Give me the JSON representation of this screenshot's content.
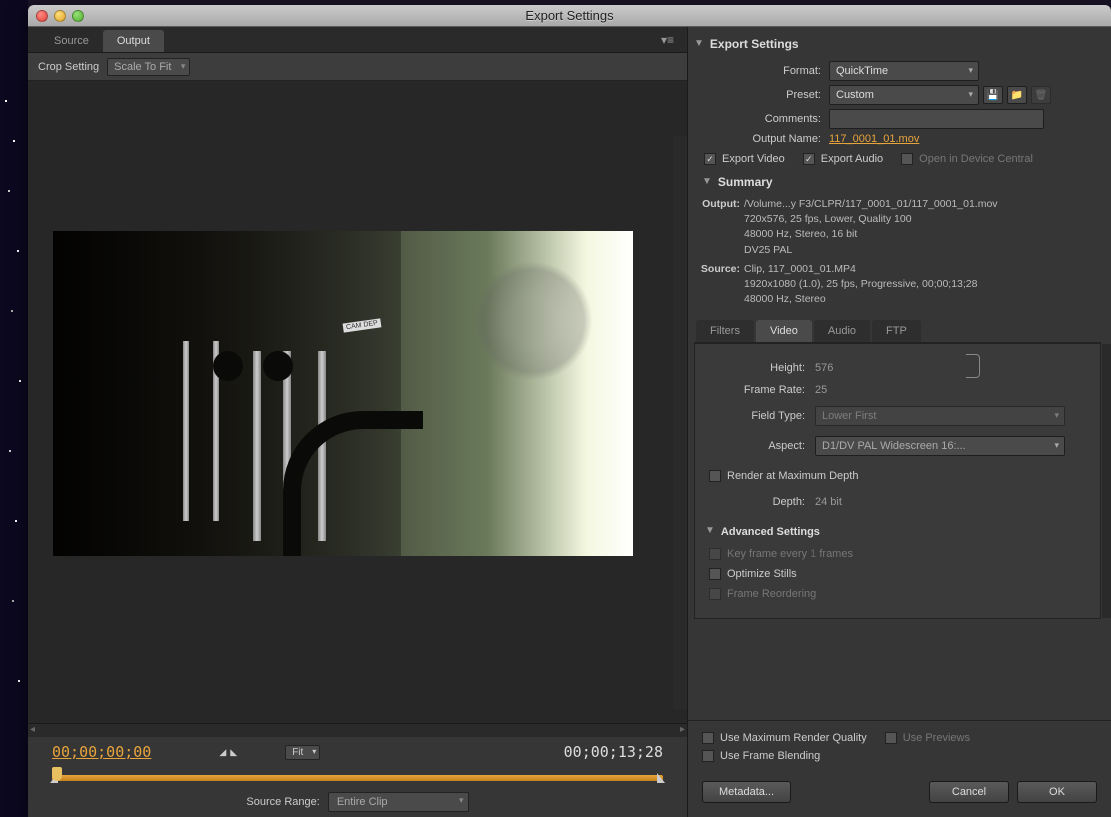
{
  "window": {
    "title": "Export Settings"
  },
  "left": {
    "tabs": {
      "source": "Source",
      "output": "Output"
    },
    "crop_label": "Crop Setting",
    "crop_value": "Scale To Fit",
    "timecode_in": "00;00;00;00",
    "timecode_out": "00;00;13;28",
    "fit_label": "Fit",
    "source_range_label": "Source Range:",
    "source_range_value": "Entire Clip",
    "preview_tag": "CAM DEP"
  },
  "export": {
    "heading": "Export Settings",
    "format_label": "Format:",
    "format_value": "QuickTime",
    "preset_label": "Preset:",
    "preset_value": "Custom",
    "comments_label": "Comments:",
    "output_name_label": "Output Name:",
    "output_name_value": "117_0001_01.mov",
    "export_video": "Export Video",
    "export_audio": "Export Audio",
    "open_device_central": "Open in Device Central"
  },
  "summary": {
    "heading": "Summary",
    "output_label": "Output:",
    "output_line1": "/Volume...y F3/CLPR/117_0001_01/117_0001_01.mov",
    "output_line2": "720x576, 25 fps, Lower, Quality 100",
    "output_line3": "48000 Hz, Stereo, 16 bit",
    "output_line4": "DV25 PAL",
    "source_label": "Source:",
    "source_line1": "Clip, 117_0001_01.MP4",
    "source_line2": "1920x1080 (1.0), 25 fps, Progressive, 00;00;13;28",
    "source_line3": "48000 Hz, Stereo"
  },
  "subtabs": {
    "filters": "Filters",
    "video": "Video",
    "audio": "Audio",
    "ftp": "FTP"
  },
  "video": {
    "height_label": "Height:",
    "height_value": "576",
    "frame_rate_label": "Frame Rate:",
    "frame_rate_value": "25",
    "field_type_label": "Field Type:",
    "field_type_value": "Lower First",
    "aspect_label": "Aspect:",
    "aspect_value": "D1/DV PAL Widescreen 16:...",
    "render_max_depth": "Render at Maximum Depth",
    "depth_label": "Depth:",
    "depth_value": "24 bit"
  },
  "advanced": {
    "heading": "Advanced Settings",
    "keyframe_label": "Key frame every",
    "keyframe_value": "1",
    "keyframe_unit": "frames",
    "optimize_stills": "Optimize Stills",
    "frame_reordering": "Frame Reordering"
  },
  "bottom": {
    "max_quality": "Use Maximum Render Quality",
    "use_previews": "Use Previews",
    "frame_blending": "Use Frame Blending"
  },
  "buttons": {
    "metadata": "Metadata...",
    "cancel": "Cancel",
    "ok": "OK"
  }
}
